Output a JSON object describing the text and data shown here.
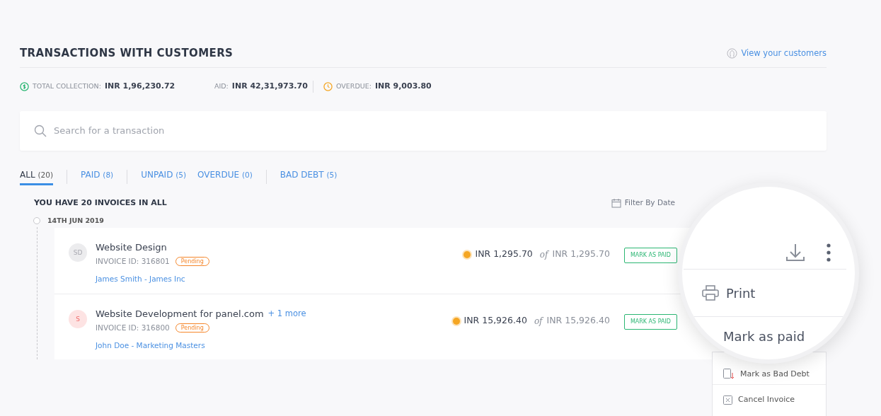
{
  "header": {
    "title": "TRANSACTIONS WITH CUSTOMERS",
    "link": "View your customers"
  },
  "stats": [
    {
      "kind": "collection",
      "label": "TOTAL COLLECTION:",
      "value": "INR 1,96,230.72"
    },
    {
      "kind": "paid",
      "label": "AID:",
      "value": "INR 42,31,973.70"
    },
    {
      "kind": "overdue",
      "label": "OVERDUE:",
      "value": "INR 9,003.80"
    }
  ],
  "search": {
    "placeholder": "Search for a transaction"
  },
  "tabs": [
    {
      "label": "ALL",
      "count": "(20)",
      "selected": true,
      "separator": false
    },
    {
      "label": "PAID",
      "count": "(8)",
      "selected": false,
      "separator": true
    },
    {
      "label": "UNPAID",
      "count": "(5)",
      "selected": false,
      "separator": true
    },
    {
      "label": "OVERDUE",
      "count": "(0)",
      "selected": false,
      "separator": false
    },
    {
      "label": "BAD DEBT",
      "count": "(5)",
      "selected": false,
      "separator": true
    }
  ],
  "summary": "YOU HAVE 20 INVOICES IN ALL",
  "filter": "Filter By Date",
  "date": "14TH JUN 2019",
  "invoices": [
    {
      "initials": "SD",
      "kind": "neutral",
      "title": "Website Design",
      "invoice_id": "INVOICE ID: 316801",
      "status": "Pending",
      "customer": "James Smith - James Inc",
      "amount": "INR 1,295.70",
      "of": "of",
      "total": "INR 1,295.70",
      "action": "MARK AS PAID"
    },
    {
      "initials": "S",
      "kind": "red",
      "title": "Website Development for panel.com",
      "more": "+ 1 more",
      "invoice_id": "INVOICE ID: 316800",
      "status": "Pending",
      "customer": "John Doe - Marketing Masters",
      "amount": "INR 15,926.40",
      "of": "of",
      "total": "INR 15,926.40",
      "action": "MARK AS PAID"
    }
  ],
  "lens": {
    "items": [
      "Print",
      "Mark as paid"
    ]
  },
  "menu": {
    "items": [
      "Mark as Bad Debt",
      "Cancel Invoice"
    ]
  }
}
